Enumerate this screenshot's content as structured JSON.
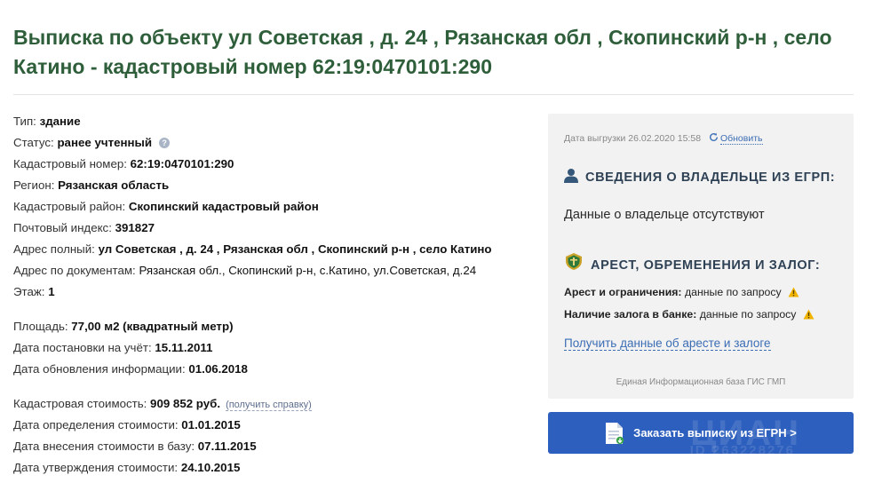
{
  "title": "Выписка по объекту ул Советская , д. 24 , Рязанская обл , Скопинский р-н , село Катино - кадастровый номер 62:19:0470101:290",
  "facts": {
    "type": {
      "label": "Тип:",
      "value": "здание"
    },
    "status": {
      "label": "Статус:",
      "value": "ранее учтенный",
      "help": "?"
    },
    "cadastral_number": {
      "label": "Кадастровый номер:",
      "value": "62:19:0470101:290"
    },
    "region": {
      "label": "Регион:",
      "value": "Рязанская область"
    },
    "district": {
      "label": "Кадастровый район:",
      "value": "Скопинский кадастровый район"
    },
    "postal": {
      "label": "Почтовый индекс:",
      "value": "391827"
    },
    "address_full": {
      "label": "Адрес полный:",
      "value": "ул Советская , д. 24 , Рязанская обл , Скопинский р-н , село Катино"
    },
    "address_docs": {
      "label": "Адрес по документам:",
      "value": "Рязанская обл., Скопинский р-н, с.Катино, ул.Советская, д.24"
    },
    "floor": {
      "label": "Этаж:",
      "value": "1"
    },
    "area": {
      "label": "Площадь:",
      "value": "77,00 м2 (квадратный метр)"
    },
    "registered": {
      "label": "Дата постановки на учёт:",
      "value": "15.11.2011"
    },
    "updated": {
      "label": "Дата обновления информации:",
      "value": "01.06.2018"
    },
    "cost": {
      "label": "Кадастровая стоимость:",
      "value": "909 852 руб.",
      "link": "(получить справку)"
    },
    "cost_determined": {
      "label": "Дата определения стоимости:",
      "value": "01.01.2015"
    },
    "cost_entered": {
      "label": "Дата внесения стоимости в базу:",
      "value": "07.11.2015"
    },
    "cost_approved": {
      "label": "Дата утверждения стоимости:",
      "value": "24.10.2015"
    }
  },
  "panel": {
    "export_date": "Дата выгрузки 26.02.2020 15:58",
    "refresh_label": "Обновить",
    "owner_heading": "СВЕДЕНИЯ О ВЛАДЕЛЬЦЕ ИЗ ЕГРП:",
    "owner_text": "Данные о владельце отсутствуют",
    "arrest_heading": "АРЕСТ, ОБРЕМЕНЕНИЯ И ЗАЛОГ:",
    "arrest_label": "Арест и ограничения:",
    "arrest_value": "данные по запросу",
    "pledge_label": "Наличие залога в банке:",
    "pledge_value": "данные по запросу",
    "arrest_link": "Получить данные об аресте и залоге",
    "base_note": "Единая Информационная база ГИС ГМП"
  },
  "cta": {
    "label": "Заказать выписку из ЕГРН >",
    "watermark": "ЦИАН",
    "watermark_id": "ID 263228276"
  },
  "colors": {
    "title": "#2e5e3a",
    "panel_bg": "#f2f2f2",
    "cta_bg": "#2d5fbe",
    "link": "#3b6db5",
    "warning": "#f0b400"
  },
  "icons": {
    "help": "question-circle-icon",
    "refresh": "refresh-icon",
    "owner": "person-icon",
    "arrest": "court-emblem-icon",
    "warning": "warning-triangle-icon",
    "document": "document-icon"
  }
}
